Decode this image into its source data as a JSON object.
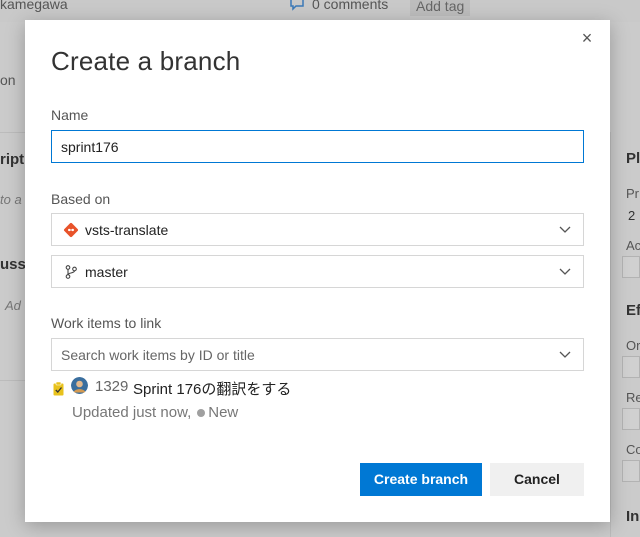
{
  "background": {
    "author_partial": "kamegawa",
    "comments": "0 comments",
    "add_tag": "Add tag",
    "left_on": "on",
    "left_ript": "ript",
    "left_to": "to a",
    "left_ussio": "ussio",
    "left_add": "Ad",
    "right_pl": "Pl",
    "right_pr": "Pr",
    "right_2": "2",
    "right_ac": "Ac",
    "right_ef": "Ef",
    "right_or": "Or",
    "right_re": "Re",
    "right_co": "Co",
    "right_in": "In"
  },
  "dialog": {
    "title": "Create a branch",
    "close_label": "×",
    "name_label": "Name",
    "name_value": "sprint176",
    "based_on_label": "Based on",
    "repo_value": "vsts-translate",
    "branch_value": "master",
    "work_items_label": "Work items to link",
    "search_placeholder": "Search work items by ID or title",
    "work_item": {
      "id": "1329",
      "title": "Sprint 176の翻訳をする",
      "updated": "Updated just now,",
      "state": "New"
    },
    "create_button": "Create branch",
    "cancel_button": "Cancel"
  },
  "colors": {
    "accent": "#0078d4",
    "git_icon": "#e8532a",
    "work_item_icon": "#e8c21c",
    "state_dot": "#a0a0a0"
  },
  "icons": {
    "repo": "git-repo-icon",
    "branch": "branch-icon",
    "chevron": "chevron-down-icon",
    "work_item": "task-icon",
    "avatar": "user-avatar",
    "close": "close-icon",
    "comment": "comment-icon"
  }
}
